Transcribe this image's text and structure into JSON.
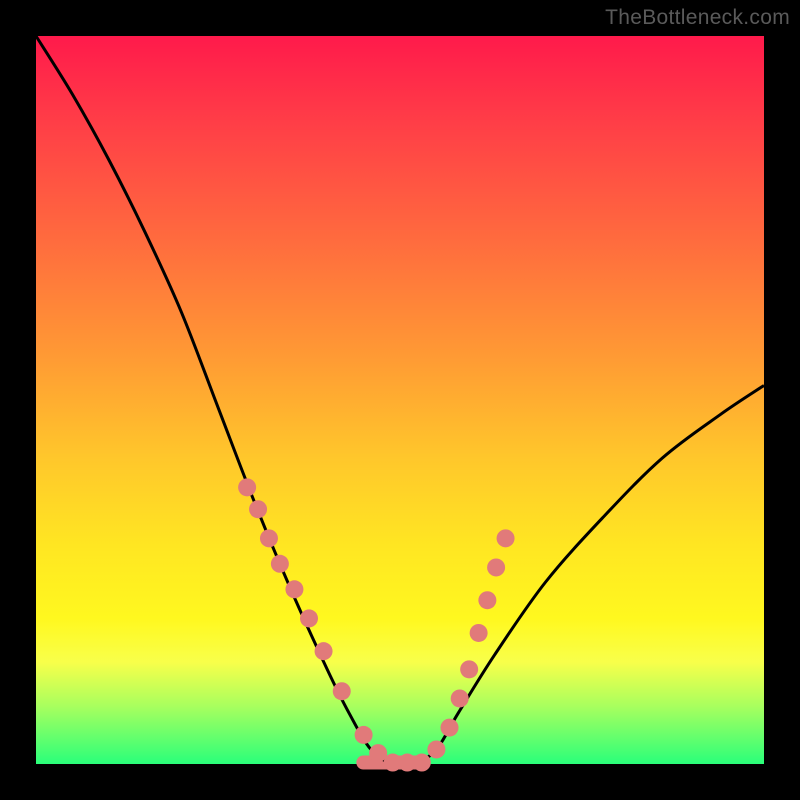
{
  "watermark": "TheBottleneck.com",
  "chart_data": {
    "type": "line",
    "title": "",
    "xlabel": "",
    "ylabel": "",
    "xlim": [
      0,
      100
    ],
    "ylim": [
      0,
      100
    ],
    "series": [
      {
        "name": "bottleneck-curve",
        "x": [
          0,
          5,
          10,
          15,
          20,
          25,
          30,
          35,
          40,
          43,
          46,
          49,
          52,
          55,
          58,
          63,
          70,
          78,
          86,
          94,
          100
        ],
        "y": [
          100,
          92,
          83,
          73,
          62,
          49,
          36,
          24,
          13,
          7,
          2,
          0,
          0,
          2,
          7,
          15,
          25,
          34,
          42,
          48,
          52
        ]
      }
    ],
    "markers": {
      "name": "highlight-dots",
      "color": "#e17a7a",
      "radius": 9,
      "x": [
        29,
        30.5,
        32,
        33.5,
        35.5,
        37.5,
        39.5,
        42,
        45,
        47,
        49,
        51,
        53,
        55,
        56.8,
        58.2,
        59.5,
        60.8,
        62,
        63.2,
        64.5
      ],
      "y": [
        38,
        35,
        31,
        27.5,
        24,
        20,
        15.5,
        10,
        4,
        1.5,
        0.2,
        0.2,
        0.2,
        2,
        5,
        9,
        13,
        18,
        22.5,
        27,
        31
      ]
    },
    "flat_segment": {
      "name": "base-bar",
      "color": "#e17a7a",
      "x0": 44,
      "x1": 54,
      "y": 0.2,
      "thickness": 14
    }
  },
  "colors": {
    "curve": "#000000",
    "curve_width": 3,
    "marker": "#e17a7a",
    "background_black": "#000000"
  }
}
